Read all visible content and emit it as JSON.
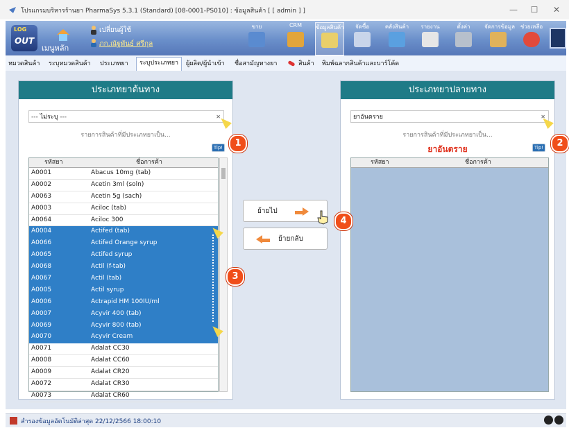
{
  "window": {
    "title": "โปรแกรมบริหารร้านยา PharmaSys 5.3.1 (Standard) [08-0001-PS010] : ข้อมูลสินค้า [ [ admin ] ]",
    "controls": {
      "minimize": "—",
      "maximize": "☐",
      "close": "✕"
    }
  },
  "toolbar": {
    "logout": {
      "line1": "LOG",
      "line2": "OUT"
    },
    "home_label": "เมนูหลัก",
    "switch_user_label": "เปลี่ยนผู้ใช้",
    "user_name": "ภก.ณัฐพันธ์ ศรีกุล",
    "items": [
      {
        "label": "ขาย",
        "icon": "cash-register-icon"
      },
      {
        "label": "CRM",
        "icon": "crm-icon"
      },
      {
        "label": "ข้อมูลสินค้า",
        "icon": "product-data-icon"
      },
      {
        "label": "จัดซื้อ",
        "icon": "purchase-icon"
      },
      {
        "label": "คลังสินค้า",
        "icon": "warehouse-icon"
      },
      {
        "label": "รายงาน",
        "icon": "report-icon"
      },
      {
        "label": "ตั้งค่า",
        "icon": "settings-icon"
      },
      {
        "label": "จัดการข้อมูล",
        "icon": "data-management-icon"
      },
      {
        "label": "ช่วยเหลือ",
        "icon": "help-icon"
      }
    ]
  },
  "tabs": [
    {
      "label": "หมวดสินค้า"
    },
    {
      "label": "ระบุหมวดสินค้า"
    },
    {
      "label": "ประเภทยา"
    },
    {
      "label": "ระบุประเภทยา"
    },
    {
      "label": "ผู้ผลิต/ผู้นำเข้า"
    },
    {
      "label": "ชื่อสามัญทางยา"
    },
    {
      "label": "สินค้า"
    },
    {
      "label": "พิมพ์ฉลากสินค้าและบาร์โค้ด"
    }
  ],
  "source": {
    "header": "ประเภทยาต้นทาง",
    "selected": "--- ไม่ระบุ ---",
    "hint": "รายการสินค้าที่มีประเภทยาเป็น...",
    "tip": "Tip!",
    "columns": [
      "รหัสยา",
      "ชื่อการค้า"
    ],
    "rows": [
      {
        "code": "A0001",
        "name": "Abacus 10mg (tab)",
        "selected": false
      },
      {
        "code": "A0002",
        "name": "Acetin 3ml (soln)",
        "selected": false
      },
      {
        "code": "A0063",
        "name": "Acetin 5g (sach)",
        "selected": false
      },
      {
        "code": "A0003",
        "name": "Aciloc (tab)",
        "selected": false
      },
      {
        "code": "A0064",
        "name": "Aciloc 300",
        "selected": false
      },
      {
        "code": "A0004",
        "name": "Actifed (tab)",
        "selected": true
      },
      {
        "code": "A0066",
        "name": "Actifed Orange syrup",
        "selected": true
      },
      {
        "code": "A0065",
        "name": "Actifed syrup",
        "selected": true
      },
      {
        "code": "A0068",
        "name": "Actil (f-tab)",
        "selected": true
      },
      {
        "code": "A0067",
        "name": "Actil (tab)",
        "selected": true
      },
      {
        "code": "A0005",
        "name": "Actil syrup",
        "selected": true
      },
      {
        "code": "A0006",
        "name": "Actrapid HM 100IU/ml",
        "selected": true
      },
      {
        "code": "A0007",
        "name": "Acyvir 400 (tab)",
        "selected": true
      },
      {
        "code": "A0069",
        "name": "Acyvir 800 (tab)",
        "selected": true
      },
      {
        "code": "A0070",
        "name": "Acyvir Cream",
        "selected": true
      },
      {
        "code": "A0071",
        "name": "Adalat CC30",
        "selected": false
      },
      {
        "code": "A0008",
        "name": "Adalat CC60",
        "selected": false
      },
      {
        "code": "A0009",
        "name": "Adalat CR20",
        "selected": false
      },
      {
        "code": "A0072",
        "name": "Adalat CR30",
        "selected": false
      },
      {
        "code": "A0073",
        "name": "Adalat CR60",
        "selected": false
      }
    ]
  },
  "actions": {
    "move_to": "ย้ายไป",
    "move_back": "ย้ายกลับ"
  },
  "destination": {
    "header": "ประเภทยาปลายทาง",
    "selected": "ยาอันตราย",
    "hint": "รายการสินค้าที่มีประเภทยาเป็น...",
    "type_label": "ยาอันตราย",
    "tip": "Tip!",
    "columns": [
      "รหัสยา",
      "ชื่อการค้า"
    ]
  },
  "callouts": [
    "1",
    "2",
    "3",
    "4"
  ],
  "status": {
    "text": "สำรองข้อมูลอัตโนมัติล่าสุด 22/12/2566 18:00:10"
  },
  "colors": {
    "header_teal": "#1f7b87",
    "selection_blue": "#2f7fc7",
    "dest_label_red": "#e0321e",
    "callout_orange": "#f04e1a"
  }
}
